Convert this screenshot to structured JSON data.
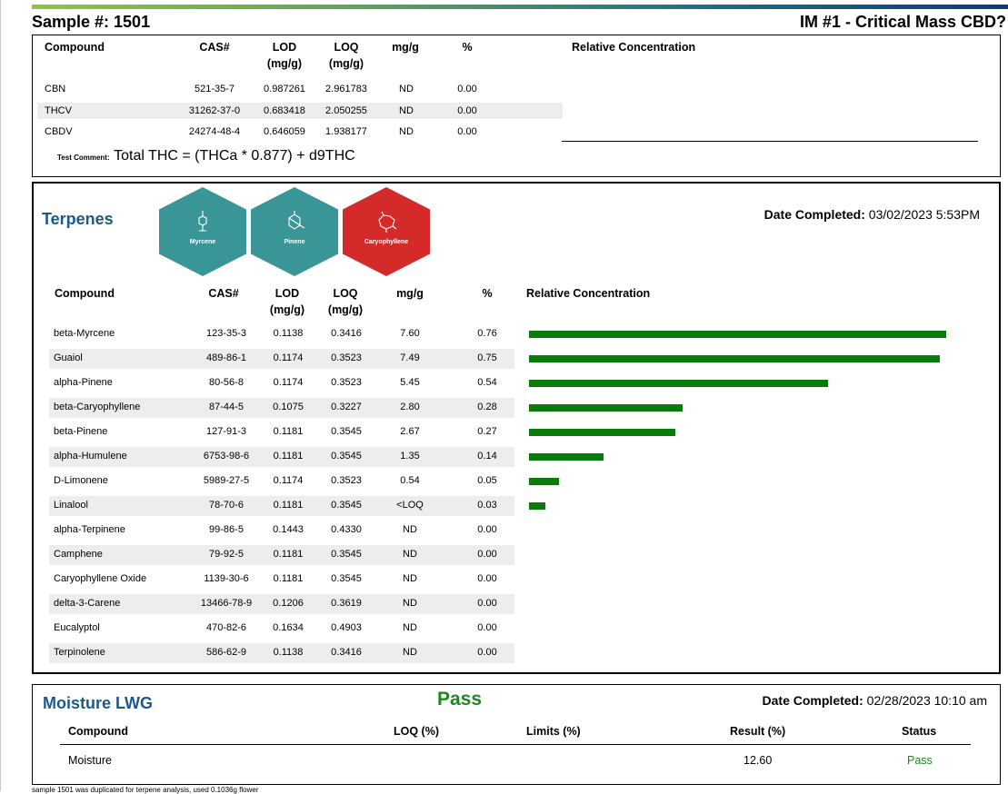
{
  "header": {
    "sample": "Sample #: 1501",
    "product": "IM #1 - Critical Mass CBD?"
  },
  "cannabinoids": {
    "columns": [
      "Compound",
      "CAS#",
      "LOD",
      "(mg/g)",
      "LOQ",
      "(mg/g)",
      "mg/g",
      "%",
      "Relative Concentration"
    ],
    "rows": [
      {
        "compound": "CBN",
        "cas": "521-35-7",
        "lod": "0.987261",
        "loq": "2.961783",
        "mgg": "ND",
        "pct": "0.00"
      },
      {
        "compound": "THCV",
        "cas": "31262-37-0",
        "lod": "0.683418",
        "loq": "2.050255",
        "mgg": "ND",
        "pct": "0.00"
      },
      {
        "compound": "CBDV",
        "cas": "24274-48-4",
        "lod": "0.646059",
        "loq": "1.938177",
        "mgg": "ND",
        "pct": "0.00"
      }
    ],
    "comment_label": "Test Comment:",
    "comment": "Total THC = (THCa * 0.877) + d9THC"
  },
  "terpenes": {
    "title": "Terpenes",
    "badges": [
      {
        "label": "Myrcene",
        "color": "#3a9696",
        "icon": "myrcene-molecule-icon"
      },
      {
        "label": "Pinene",
        "color": "#3a9696",
        "icon": "pinene-molecule-icon"
      },
      {
        "label": "Caryophyllene",
        "color": "#d42a2a",
        "icon": "caryophyllene-molecule-icon"
      }
    ],
    "date_label": "Date Completed:",
    "date_value": "03/02/2023   5:53PM",
    "columns": [
      "Compound",
      "CAS#",
      "LOD",
      "(mg/g)",
      "LOQ",
      "(mg/g)",
      "mg/g",
      "%",
      "Relative Concentration"
    ],
    "bar_color": "#0a7a0a",
    "rows": [
      {
        "compound": "beta-Myrcene",
        "cas": "123-35-3",
        "lod": "0.1138",
        "loq": "0.3416",
        "mgg": "7.60",
        "pct": "0.76",
        "rel": 1.0
      },
      {
        "compound": "Guaiol",
        "cas": "489-86-1",
        "lod": "0.1174",
        "loq": "0.3523",
        "mgg": "7.49",
        "pct": "0.75",
        "rel": 0.985
      },
      {
        "compound": "alpha-Pinene",
        "cas": "80-56-8",
        "lod": "0.1174",
        "loq": "0.3523",
        "mgg": "5.45",
        "pct": "0.54",
        "rel": 0.717
      },
      {
        "compound": "beta-Caryophyllene",
        "cas": "87-44-5",
        "lod": "0.1075",
        "loq": "0.3227",
        "mgg": "2.80",
        "pct": "0.28",
        "rel": 0.368
      },
      {
        "compound": "beta-Pinene",
        "cas": "127-91-3",
        "lod": "0.1181",
        "loq": "0.3545",
        "mgg": "2.67",
        "pct": "0.27",
        "rel": 0.351
      },
      {
        "compound": "alpha-Humulene",
        "cas": "6753-98-6",
        "lod": "0.1181",
        "loq": "0.3545",
        "mgg": "1.35",
        "pct": "0.14",
        "rel": 0.178
      },
      {
        "compound": "D-Limonene",
        "cas": "5989-27-5",
        "lod": "0.1174",
        "loq": "0.3523",
        "mgg": "0.54",
        "pct": "0.05",
        "rel": 0.071
      },
      {
        "compound": "Linalool",
        "cas": "78-70-6",
        "lod": "0.1181",
        "loq": "0.3545",
        "mgg": "<LOQ",
        "pct": "0.03",
        "rel": 0.04
      },
      {
        "compound": "alpha-Terpinene",
        "cas": "99-86-5",
        "lod": "0.1443",
        "loq": "0.4330",
        "mgg": "ND",
        "pct": "0.00",
        "rel": 0
      },
      {
        "compound": "Camphene",
        "cas": "79-92-5",
        "lod": "0.1181",
        "loq": "0.3545",
        "mgg": "ND",
        "pct": "0.00",
        "rel": 0
      },
      {
        "compound": "Caryophyllene Oxide",
        "cas": "1139-30-6",
        "lod": "0.1181",
        "loq": "0.3545",
        "mgg": "ND",
        "pct": "0.00",
        "rel": 0
      },
      {
        "compound": "delta-3-Carene",
        "cas": "13466-78-9",
        "lod": "0.1206",
        "loq": "0.3619",
        "mgg": "ND",
        "pct": "0.00",
        "rel": 0
      },
      {
        "compound": "Eucalyptol",
        "cas": "470-82-6",
        "lod": "0.1634",
        "loq": "0.4903",
        "mgg": "ND",
        "pct": "0.00",
        "rel": 0
      },
      {
        "compound": "Terpinolene",
        "cas": "586-62-9",
        "lod": "0.1138",
        "loq": "0.3416",
        "mgg": "ND",
        "pct": "0.00",
        "rel": 0
      }
    ]
  },
  "moisture": {
    "title": "Moisture LWG",
    "result_status": "Pass",
    "pass_color": "#1a8a1a",
    "date_label": "Date Completed:",
    "date_value": "02/28/2023  10:10 am",
    "columns": [
      "Compound",
      "LOQ (%)",
      "Limits (%)",
      "Result (%)",
      "Status"
    ],
    "row": {
      "compound": "Moisture",
      "loq": "",
      "limits": "",
      "result": "12.60",
      "status": "Pass"
    }
  },
  "footnote": "sample 1501 was duplicated for terpene analysis, used 0.1036g flower"
}
